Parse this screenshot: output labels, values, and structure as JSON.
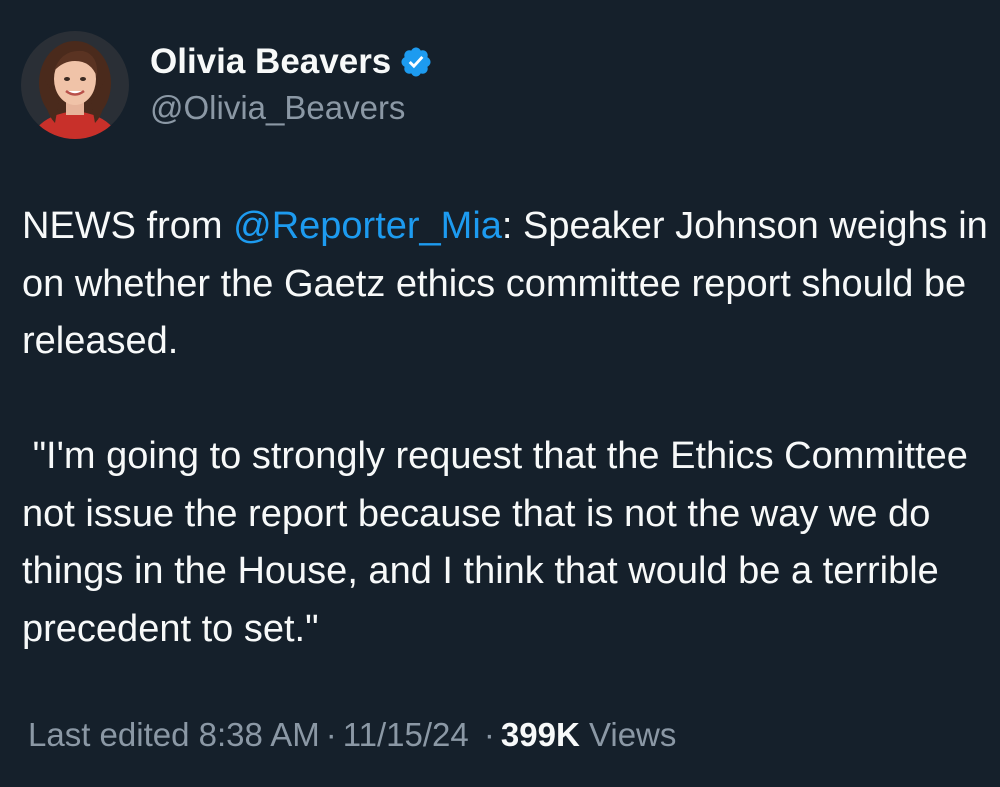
{
  "author": {
    "display_name": "Olivia Beavers",
    "handle": "@Olivia_Beavers",
    "verified": true,
    "avatar": "profile-photo"
  },
  "tweet": {
    "p1_before": "NEWS from ",
    "p1_mention": "@Reporter_Mia",
    "p1_after": ": Speaker Johnson weighs in on whether the Gaetz ethics committee report should be released.",
    "p2": " \"I'm going to strongly request that the Ethics Committee not issue the report because that is not the way we do things in the House, and I think that would be a terrible precedent to set.\""
  },
  "meta": {
    "edited_label": "Last edited 8:38 AM",
    "separator": "·",
    "date": "11/15/24",
    "views_count": "399K",
    "views_label": "Views"
  },
  "colors": {
    "background": "#15202b",
    "text": "#f7f9f9",
    "secondary_text": "#8b98a5",
    "link": "#1d9bf0",
    "verified_badge": "#1d9bf0"
  }
}
